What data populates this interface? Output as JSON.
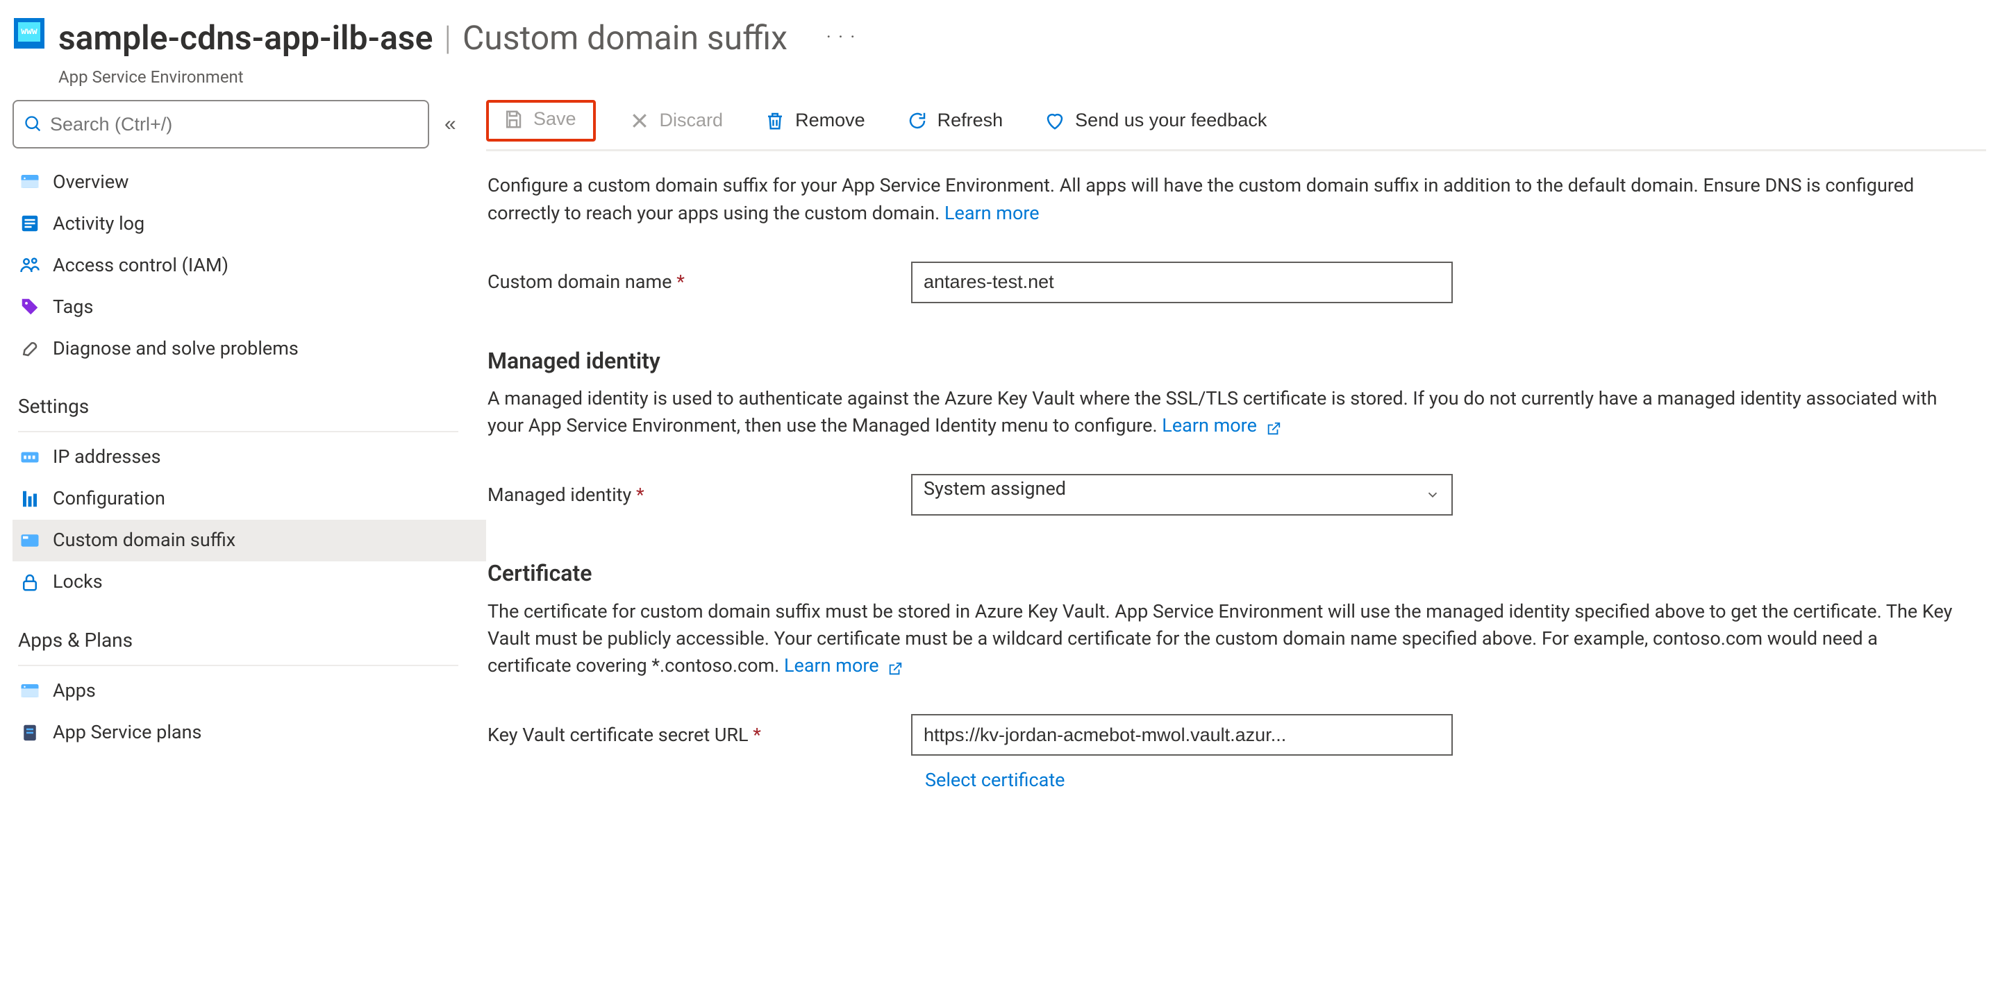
{
  "header": {
    "resource_name": "sample-cdns-app-ilb-ase",
    "separator": "|",
    "section": "Custom domain suffix",
    "subtype": "App Service Environment",
    "icon_label": "www",
    "ellipsis": "· · ·"
  },
  "search": {
    "placeholder": "Search (Ctrl+/)"
  },
  "nav": {
    "items": [
      {
        "icon": "overview",
        "label": "Overview"
      },
      {
        "icon": "activity",
        "label": "Activity log"
      },
      {
        "icon": "iam",
        "label": "Access control (IAM)"
      },
      {
        "icon": "tag",
        "label": "Tags"
      },
      {
        "icon": "diagnose",
        "label": "Diagnose and solve problems"
      }
    ],
    "group_settings": "Settings",
    "settings_items": [
      {
        "icon": "ip",
        "label": "IP addresses"
      },
      {
        "icon": "config",
        "label": "Configuration"
      },
      {
        "icon": "custom",
        "label": "Custom domain suffix",
        "selected": true
      },
      {
        "icon": "locks",
        "label": "Locks"
      }
    ],
    "group_apps": "Apps & Plans",
    "apps_items": [
      {
        "icon": "apps",
        "label": "Apps"
      },
      {
        "icon": "plans",
        "label": "App Service plans"
      }
    ]
  },
  "toolbar": {
    "save": "Save",
    "discard": "Discard",
    "remove": "Remove",
    "refresh": "Refresh",
    "feedback": "Send us your feedback"
  },
  "content": {
    "intro_a": "Configure a custom domain suffix for your App Service Environment. All apps will have the custom domain suffix in addition to the default domain. Ensure DNS is configured correctly to reach your apps using the custom domain. ",
    "learn_more": "Learn more",
    "custom_domain_label": "Custom domain name",
    "custom_domain_value": "antares-test.net",
    "mi_heading": "Managed identity",
    "mi_desc": "A managed identity is used to authenticate against the Azure Key Vault where the SSL/TLS certificate is stored. If you do not currently have a managed identity associated with your App Service Environment, then use the Managed Identity menu to configure. ",
    "mi_label": "Managed identity",
    "mi_value": "System assigned",
    "cert_heading": "Certificate",
    "cert_desc": "The certificate for custom domain suffix must be stored in Azure Key Vault. App Service Environment will use the managed identity specified above to get the certificate. The Key Vault must be publicly accessible. Your certificate must be a wildcard certificate for the custom domain name specified above. For example, contoso.com would need a certificate covering *.contoso.com. ",
    "kv_label": "Key Vault certificate secret URL",
    "kv_value": "https://kv-jordan-acmebot-mwol.vault.azur...",
    "select_cert": "Select certificate"
  }
}
